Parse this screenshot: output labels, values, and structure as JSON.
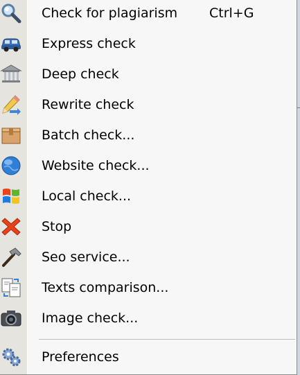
{
  "menu": {
    "items": [
      {
        "label": "Check for plagiarism",
        "shortcut": "Ctrl+G",
        "icon": "magnifier-icon"
      },
      {
        "label": "Express check",
        "icon": "car-icon"
      },
      {
        "label": "Deep check",
        "icon": "bank-icon"
      },
      {
        "label": "Rewrite check",
        "icon": "pencil-icon"
      },
      {
        "label": "Batch check...",
        "icon": "box-icon"
      },
      {
        "label": "Website check...",
        "icon": "globe-icon"
      },
      {
        "label": "Local check...",
        "icon": "windows-logo-icon"
      },
      {
        "label": "Stop",
        "icon": "stop-x-icon"
      },
      {
        "label": "Seo service...",
        "icon": "hammer-icon"
      },
      {
        "label": "Texts comparison...",
        "icon": "compare-documents-icon"
      },
      {
        "label": "Image check...",
        "icon": "camera-icon"
      },
      {
        "label": "Preferences",
        "icon": "gears-icon"
      }
    ]
  },
  "colors": {
    "menu_background": "#f7f7f7",
    "icon_gutter": "#e6e4df",
    "stop_red": "#e8411a",
    "globe_blue": "#2f7fd6"
  }
}
